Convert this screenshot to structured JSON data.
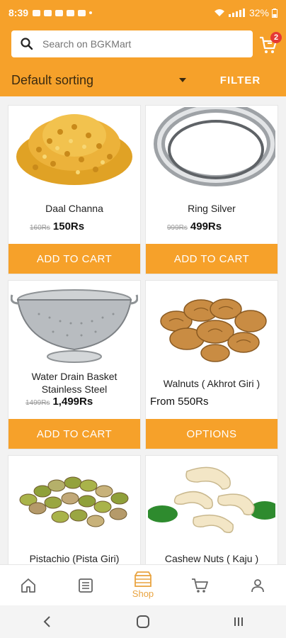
{
  "status": {
    "time": "8:39",
    "battery": "32%"
  },
  "search": {
    "placeholder": "Search on BGKMart"
  },
  "cart": {
    "badge": "2"
  },
  "sort": {
    "label": "Default sorting",
    "filter_label": "FILTER"
  },
  "products": [
    {
      "name": "Daal Channa",
      "old_price": "160Rs",
      "price": "150Rs",
      "button": "ADD TO CART"
    },
    {
      "name": "Ring Silver",
      "old_price": "999Rs",
      "price": "499Rs",
      "button": "ADD TO CART"
    },
    {
      "name": "Water Drain Basket Stainless Steel",
      "old_price": "1499Rs",
      "price": "1,499Rs",
      "button": "ADD TO CART"
    },
    {
      "name": "Walnuts ( Akhrot Giri )",
      "price_text": "From 550Rs",
      "button": "OPTIONS"
    },
    {
      "name": "Pistachio (Pista Giri)"
    },
    {
      "name": "Cashew Nuts ( Kaju )"
    }
  ],
  "nav": {
    "shop_label": "Shop"
  },
  "colors": {
    "accent": "#f6a12a",
    "badge": "#e53935"
  }
}
